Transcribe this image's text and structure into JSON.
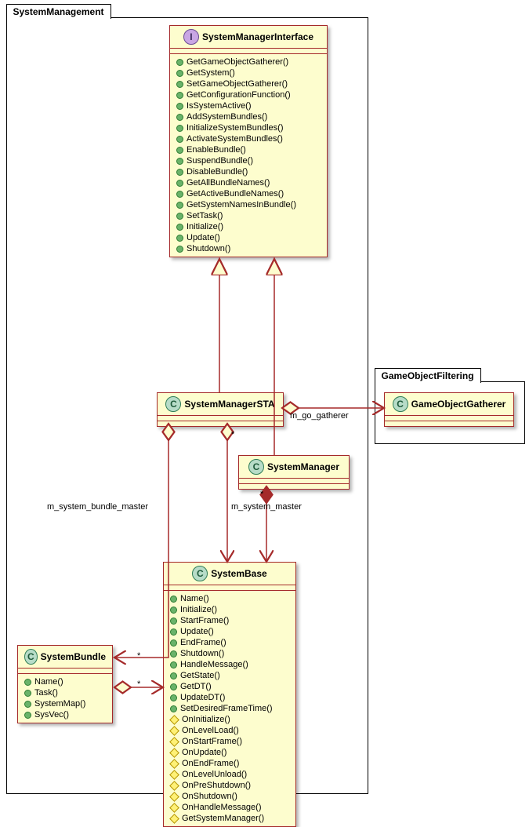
{
  "packages": {
    "systemManagement": "SystemManagement",
    "gameObjectFiltering": "GameObjectFiltering"
  },
  "classes": {
    "smi": {
      "title": "SystemManagerInterface",
      "methods": [
        "GetGameObjectGatherer()",
        "GetSystem()",
        "SetGameObjectGatherer()",
        "GetConfigurationFunction()",
        "IsSystemActive()",
        "AddSystemBundles()",
        "InitializeSystemBundles()",
        "ActivateSystemBundles()",
        "EnableBundle()",
        "SuspendBundle()",
        "DisableBundle()",
        "GetAllBundleNames()",
        "GetActiveBundleNames()",
        "GetSystemNamesInBundle()",
        "SetTask()",
        "Initialize()",
        "Update()",
        "Shutdown()"
      ]
    },
    "sta": {
      "title": "SystemManagerSTA"
    },
    "sm": {
      "title": "SystemManager"
    },
    "gog": {
      "title": "GameObjectGatherer"
    },
    "sb": {
      "title": "SystemBase",
      "public": [
        "Name()",
        "Initialize()",
        "StartFrame()",
        "Update()",
        "EndFrame()",
        "Shutdown()",
        "HandleMessage()",
        "GetState()",
        "GetDT()",
        "UpdateDT()",
        "SetDesiredFrameTime()"
      ],
      "protected": [
        "OnInitialize()",
        "OnLevelLoad()",
        "OnStartFrame()",
        "OnUpdate()",
        "OnEndFrame()",
        "OnLevelUnload()",
        "OnPreShutdown()",
        "OnShutdown()",
        "OnHandleMessage()",
        "GetSystemManager()"
      ]
    },
    "bundle": {
      "title": "SystemBundle",
      "methods": [
        "Name()",
        "Task()",
        "SystemMap()",
        "SysVec()"
      ]
    }
  },
  "labels": {
    "goGatherer": "m_go_gatherer",
    "bundleMaster": "m_system_bundle_master",
    "systemMaster": "m_system_master",
    "star": "*"
  },
  "chart_data": {
    "type": "diagram",
    "diagram_type": "uml-class",
    "packages": [
      {
        "name": "SystemManagement",
        "contains": [
          "SystemManagerInterface",
          "SystemManagerSTA",
          "SystemManager",
          "SystemBase",
          "SystemBundle"
        ]
      },
      {
        "name": "GameObjectFiltering",
        "contains": [
          "GameObjectGatherer"
        ]
      }
    ],
    "relations": [
      {
        "from": "SystemManagerSTA",
        "to": "SystemManagerInterface",
        "type": "realization"
      },
      {
        "from": "SystemManager",
        "to": "SystemManagerInterface",
        "type": "realization"
      },
      {
        "from": "SystemManagerSTA",
        "to": "GameObjectGatherer",
        "type": "aggregation",
        "role": "m_go_gatherer"
      },
      {
        "from": "SystemManagerSTA",
        "to": "SystemBase",
        "type": "aggregation",
        "multiplicity": "*"
      },
      {
        "from": "SystemManagerSTA",
        "to": "SystemBundle",
        "type": "aggregation",
        "role": "m_system_bundle_master",
        "multiplicity": "*"
      },
      {
        "from": "SystemManager",
        "to": "SystemBase",
        "type": "composition",
        "role": "m_system_master",
        "multiplicity": "*"
      },
      {
        "from": "SystemBundle",
        "to": "SystemBase",
        "type": "aggregation",
        "multiplicity": "*"
      }
    ]
  }
}
